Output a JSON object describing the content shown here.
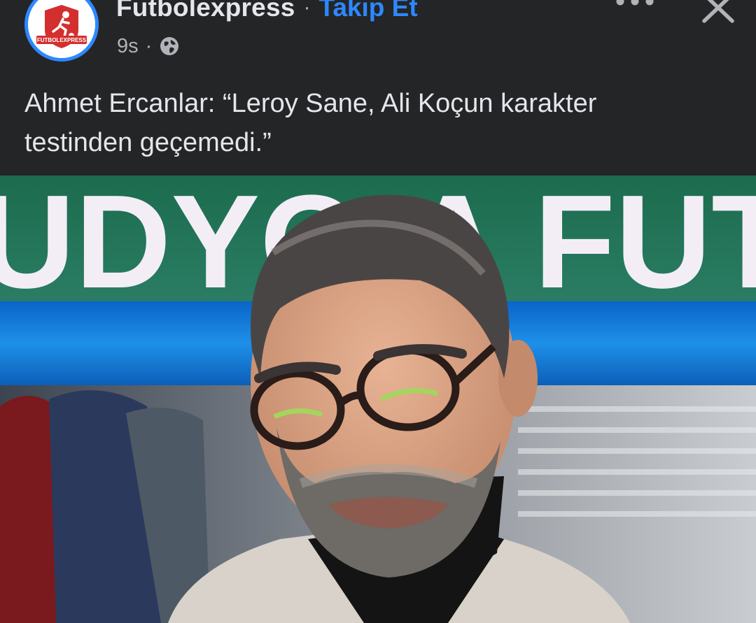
{
  "post": {
    "author": "Futbolexpress",
    "follow_label": "Takip Et",
    "time_ago": "9s",
    "separator": "·",
    "text_line1": "Ahmet Ercanlar: “Leroy Sane, Ali Koçun karakter",
    "text_line2": "testinden geçemedi.”",
    "avatar_logo_text": "FUTBOLEXPRESS"
  },
  "icons": {
    "globe": "globe-icon",
    "more": "more-dots-icon",
    "close": "close-icon"
  },
  "colors": {
    "background": "#242526",
    "text_primary": "#e4e6eb",
    "text_secondary": "#b0b3b8",
    "accent_blue": "#2d88ff",
    "logo_red": "#d32f2f"
  }
}
